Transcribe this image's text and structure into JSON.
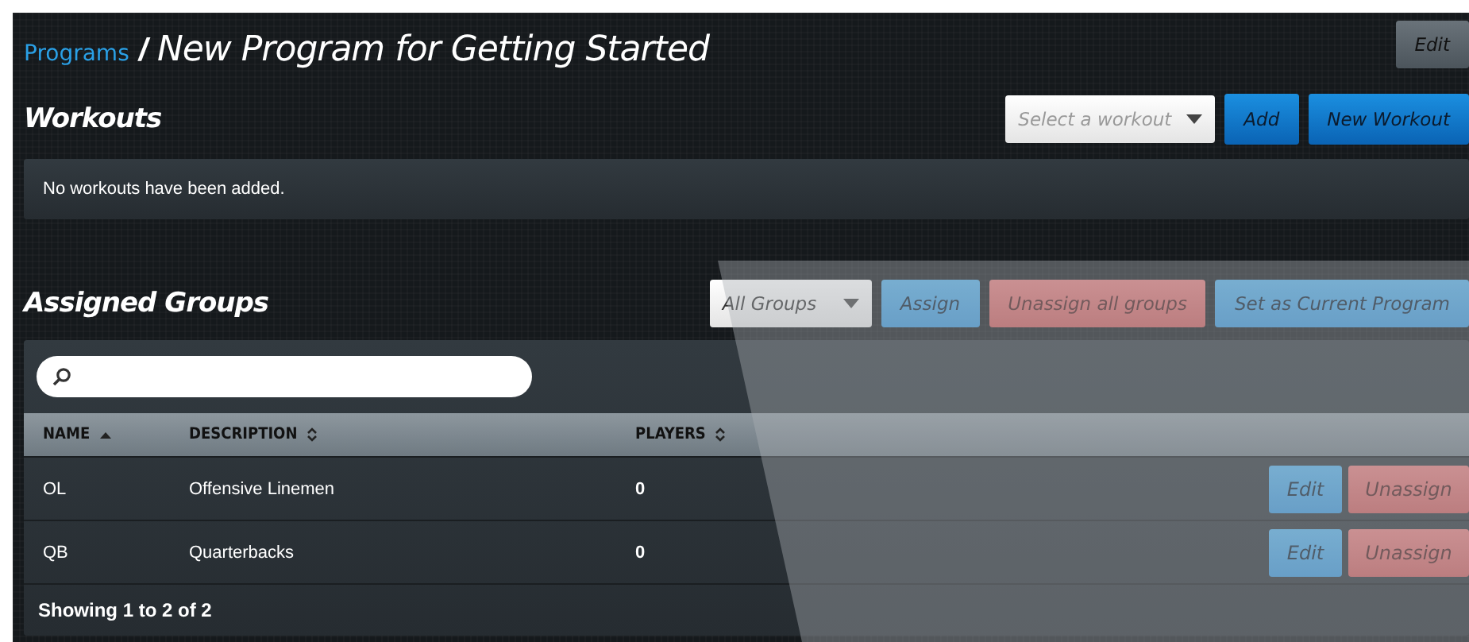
{
  "breadcrumb": {
    "link": "Programs",
    "separator": "/",
    "title": "New Program for Getting Started"
  },
  "header_buttons": [
    {
      "label": "Edit",
      "kind": "secondary"
    }
  ],
  "workouts": {
    "title": "Workouts",
    "select": {
      "placeholder": "Select a workout"
    },
    "buttons": [
      {
        "label": "Add",
        "kind": "primary"
      },
      {
        "label": "New Workout",
        "kind": "primary"
      }
    ],
    "empty_text": "No workouts have been added."
  },
  "assigned_groups": {
    "title": "Assigned Groups",
    "filter": {
      "value": "All Groups"
    },
    "buttons": [
      {
        "label": "Assign",
        "kind": "info"
      },
      {
        "label": "Unassign all groups",
        "kind": "danger"
      },
      {
        "label": "Set as Current Program",
        "kind": "info"
      }
    ],
    "table": {
      "columns": [
        {
          "label": "NAME",
          "sorted": true
        },
        {
          "label": "DESCRIPTION",
          "sorted": false
        },
        {
          "label": "PLAYERS",
          "sorted": false
        }
      ],
      "rows": [
        {
          "cells": [
            "OL",
            "Offensive Linemen",
            "0"
          ],
          "actions": [
            {
              "label": "Edit",
              "kind": "info"
            },
            {
              "label": "Unassign",
              "kind": "danger"
            }
          ]
        },
        {
          "cells": [
            "QB",
            "Quarterbacks",
            "0"
          ],
          "actions": [
            {
              "label": "Edit",
              "kind": "info"
            },
            {
              "label": "Unassign",
              "kind": "danger"
            }
          ]
        }
      ],
      "footer": "Showing 1 to 2 of 2"
    }
  }
}
